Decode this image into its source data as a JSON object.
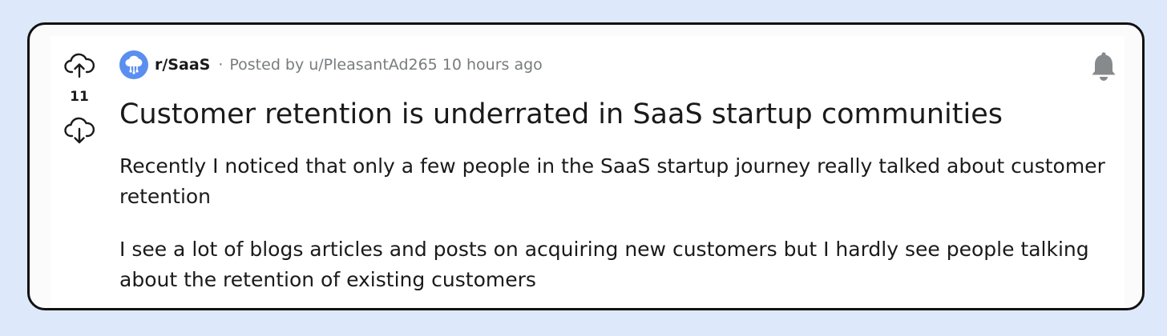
{
  "post": {
    "subreddit": "r/SaaS",
    "separator": "·",
    "posted_by_prefix": "Posted by",
    "author": "u/PleasantAd265",
    "time_ago": "10 hours ago",
    "vote_count": "11",
    "title": "Customer retention is underrated in SaaS startup communities",
    "paragraphs": [
      "Recently I noticed that only a few people in the SaaS startup journey really talked about customer retention",
      "I see a lot of blogs articles and posts on acquiring new customers but I hardly see people talking about the retention of existing customers"
    ]
  },
  "icons": {
    "upvote": "cloud-upload-icon",
    "downvote": "cloud-download-icon",
    "subreddit_avatar": "cloud-network-icon",
    "notify": "bell-icon"
  },
  "colors": {
    "background": "#dde9fb",
    "frame_border": "#111111",
    "card": "#ffffff",
    "avatar": "#5a8ef0",
    "meta_text": "#787c7e",
    "text": "#1a1a1b",
    "bell": "#878a8c"
  }
}
